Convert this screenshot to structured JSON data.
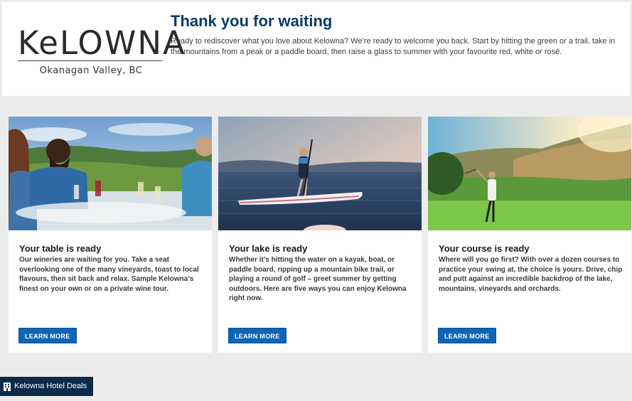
{
  "header": {
    "logo_word": "KeLOWNA",
    "logo_sub": "Okanagan Valley, BC",
    "title": "Thank you for waiting",
    "text": "Ready to rediscover what you love about Kelowna? We’re ready to welcome you back. Start by hitting the green or a trail, take in the mountains from a peak or a paddle board, then raise a glass to summer with your favourite red, white or rosé."
  },
  "cards": [
    {
      "title": "Your table is ready",
      "text": "Our wineries are waiting for you. Take a seat overlooking one of the many vineyards, toast to local flavours, then sit back and relax. Sample Kelowna’s finest on your own or on a private wine tour.",
      "button": "LEARN MORE",
      "image": "winery-dining-photo"
    },
    {
      "title": "Your lake is ready",
      "text": "Whether it’s hitting the water on a kayak, boat, or paddle board, ripping up a mountain bike trail, or playing a round of golf – greet summer by getting outdoors. Here are five ways you can enjoy Kelowna right now.",
      "button": "LEARN MORE",
      "image": "paddle-board-lake-photo"
    },
    {
      "title": "Your course is ready",
      "text": "Where will you go first? With over a dozen courses to practice your swing at, the choice is yours. Drive, chip and putt against an incredible backdrop of the lake, mountains, vineyards and orchards.",
      "button": "LEARN MORE",
      "image": "golf-course-photo"
    }
  ],
  "deals_button": {
    "label": "Kelowna Hotel Deals",
    "icon": "hotel-icon"
  },
  "colors": {
    "navy": "#0d3a66",
    "button_blue": "#0f65b5",
    "deals_bg": "#0b2b49"
  }
}
